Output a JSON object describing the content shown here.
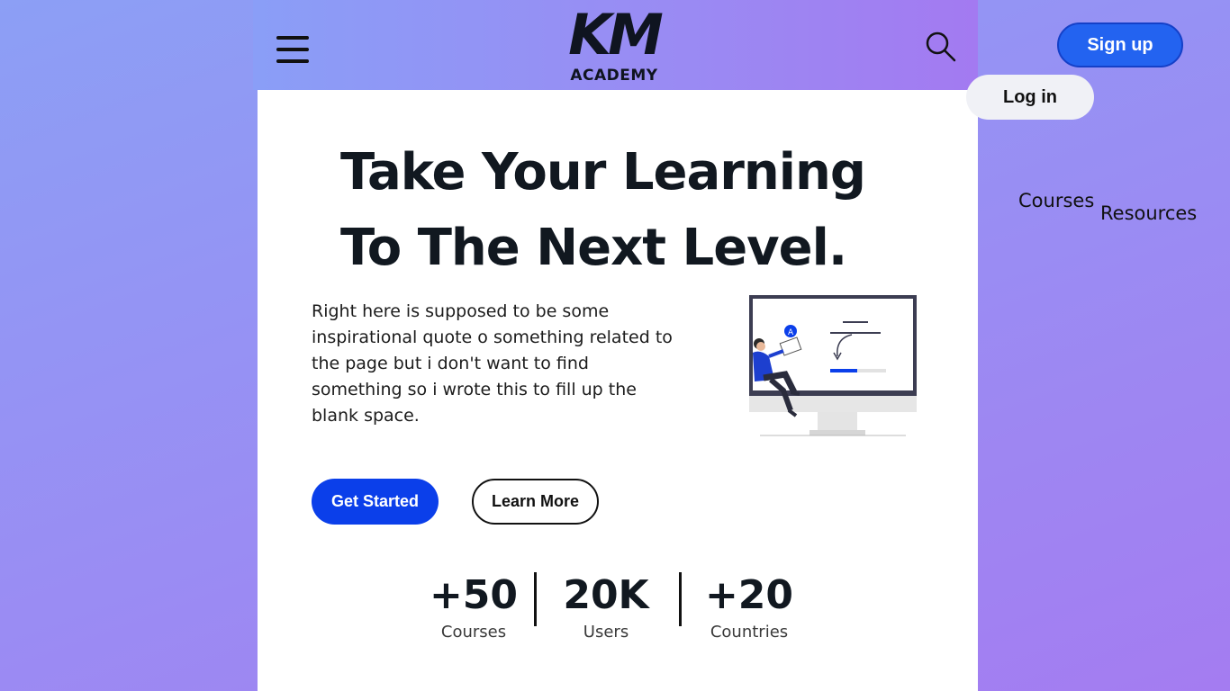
{
  "header": {
    "logo_main": "KM",
    "logo_sub": "ACADEMY"
  },
  "hero": {
    "headline_line1": "Take Your Learning",
    "headline_line2": "To The Next Level.",
    "quote": "Right here is supposed to be some inspirational quote o something related to the page but i don't want to find something so i wrote this to fill up the blank space.",
    "primary_button": "Get Started",
    "secondary_button": "Learn More"
  },
  "stats": [
    {
      "value": "+50",
      "label": "Courses"
    },
    {
      "value": "20K",
      "label": "Users"
    },
    {
      "value": "+20",
      "label": "Countries"
    }
  ],
  "side_nav": {
    "signup_label": "Sign up",
    "login_label": "Log in",
    "links": [
      "Courses",
      "Resources"
    ]
  },
  "colors": {
    "primary": "#0b3fea",
    "signup": "#2363f0",
    "text": "#111820"
  },
  "icons": [
    "hamburger-menu-icon",
    "search-icon"
  ]
}
